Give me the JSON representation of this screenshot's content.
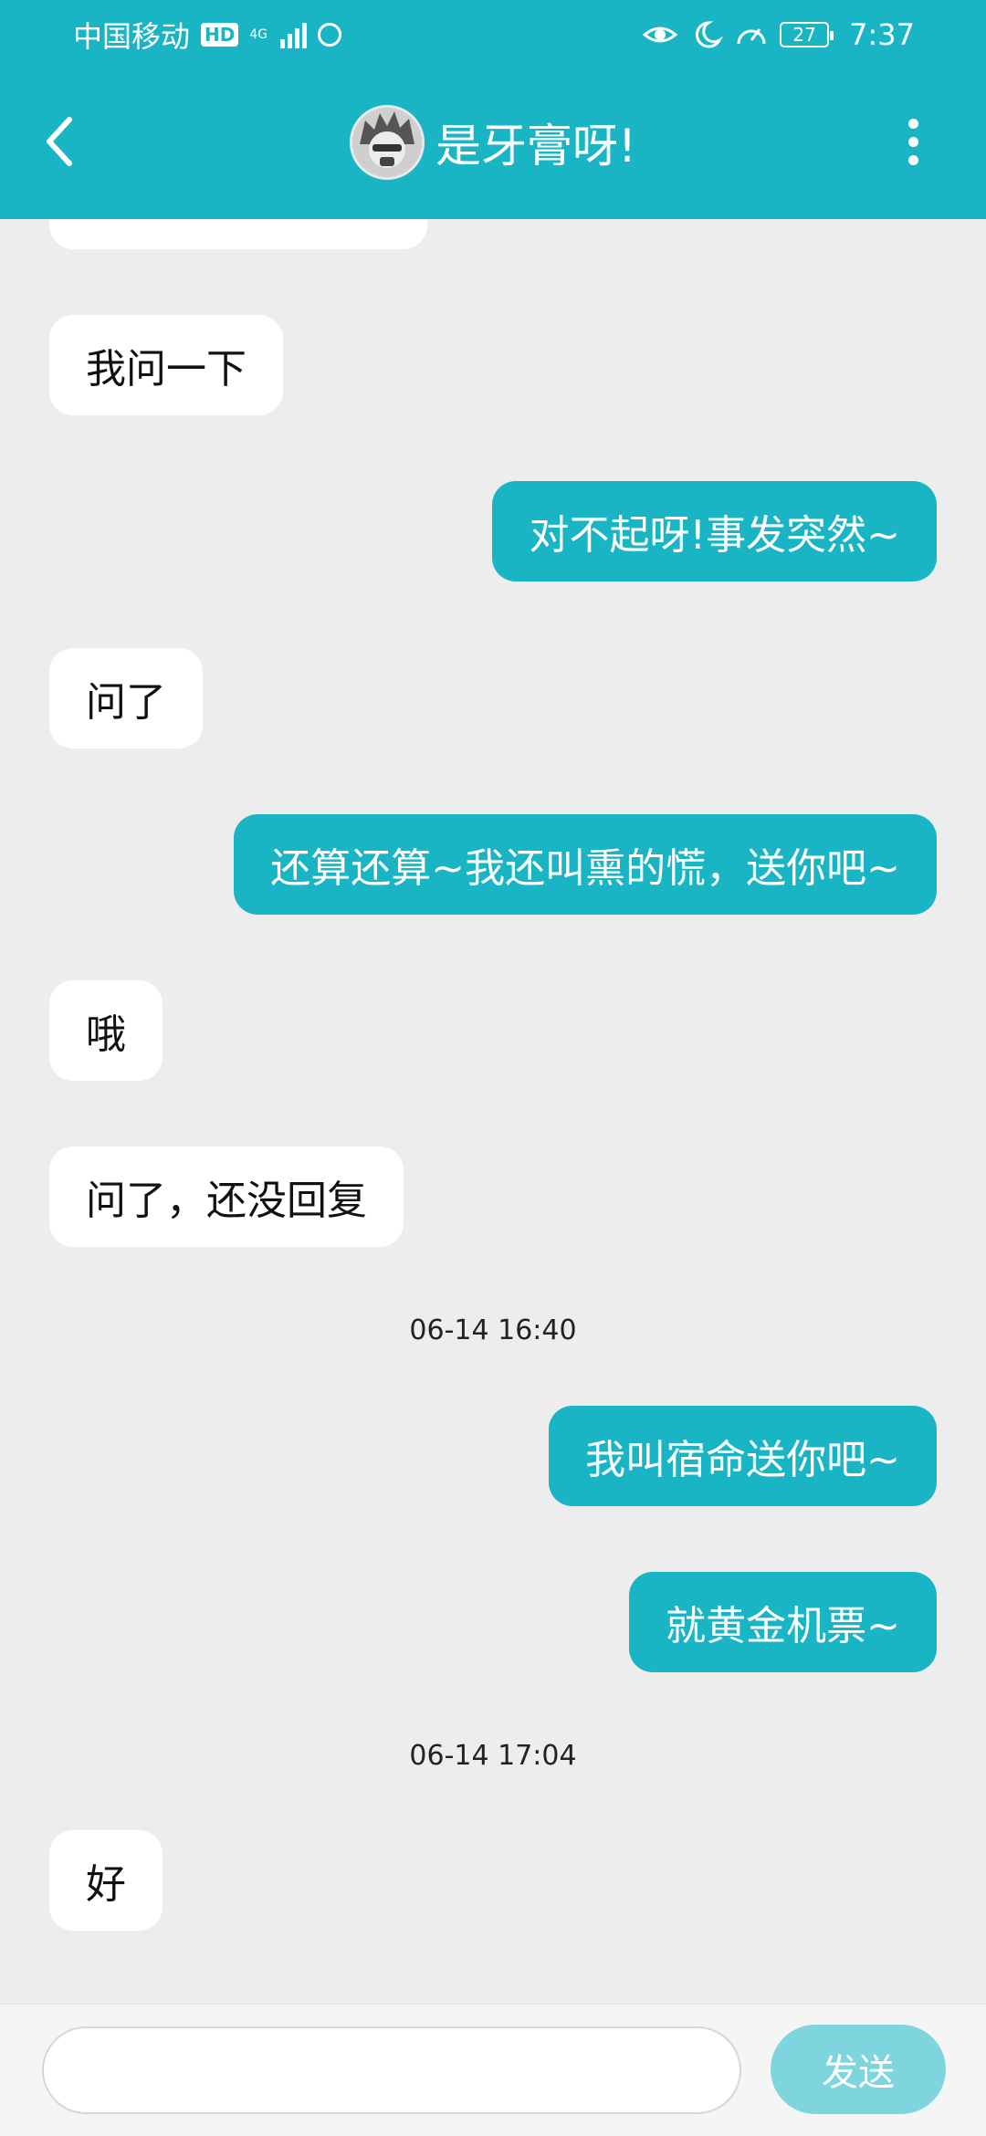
{
  "status_bar": {
    "carrier": "中国移动",
    "hd_badge": "HD",
    "network": "4G",
    "battery": "27",
    "time": "7:37"
  },
  "nav": {
    "title": "是牙膏呀!"
  },
  "messages": [
    {
      "side": "in",
      "text": "我问一下"
    },
    {
      "side": "out",
      "text": "对不起呀!事发突然~"
    },
    {
      "side": "in",
      "text": "问了"
    },
    {
      "side": "out",
      "text": "还算还算~我还叫熏的慌，送你吧~"
    },
    {
      "side": "in",
      "text": "哦"
    },
    {
      "side": "in",
      "text": "问了，还没回复"
    },
    {
      "side": "time",
      "text": "06-14  16:40"
    },
    {
      "side": "out",
      "text": "我叫宿命送你吧~"
    },
    {
      "side": "out",
      "text": "就黄金机票~"
    },
    {
      "side": "time",
      "text": "06-14  17:04"
    },
    {
      "side": "in",
      "text": "好"
    }
  ],
  "composer": {
    "input_value": "",
    "send_label": "发送"
  },
  "colors": {
    "accent": "#1ab5c4",
    "background": "#ededed",
    "send_disabled": "#7fd5dd"
  }
}
